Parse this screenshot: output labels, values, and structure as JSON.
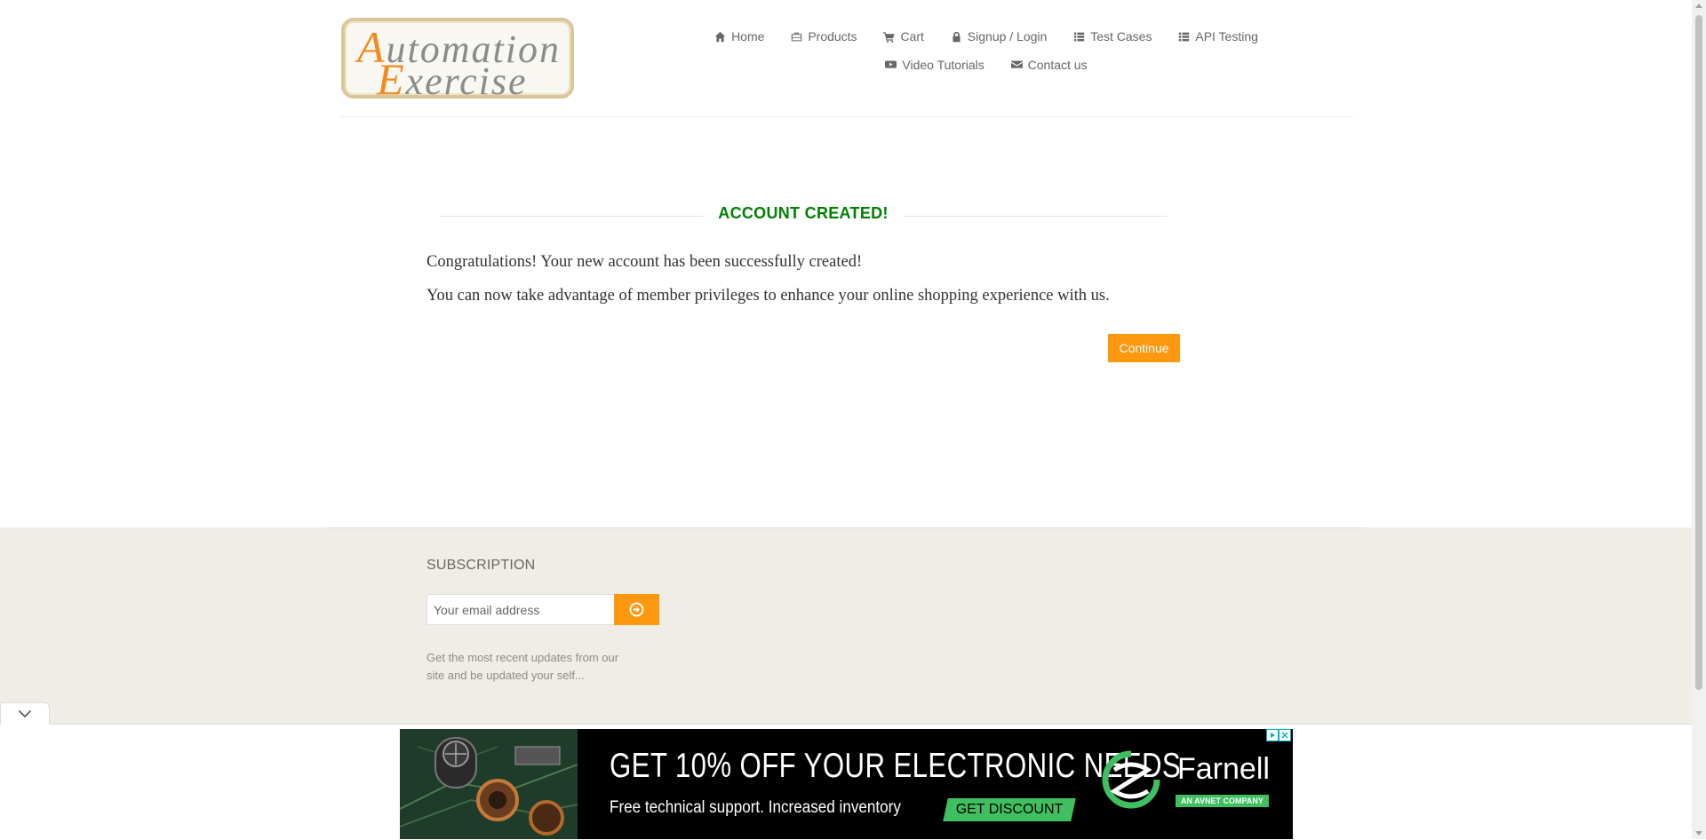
{
  "logo": {
    "line1_cap": "A",
    "line1_rest": "utomation",
    "line2_cap": "E",
    "line2_rest": "xercise"
  },
  "nav": {
    "items": [
      {
        "label": "Home",
        "icon": "home-icon"
      },
      {
        "label": "Products",
        "icon": "briefcase-icon"
      },
      {
        "label": "Cart",
        "icon": "cart-icon"
      },
      {
        "label": "Signup / Login",
        "icon": "lock-icon"
      },
      {
        "label": "Test Cases",
        "icon": "list-icon"
      },
      {
        "label": "API Testing",
        "icon": "list-icon"
      },
      {
        "label": "Video Tutorials",
        "icon": "youtube-play-icon"
      },
      {
        "label": "Contact us",
        "icon": "envelope-icon"
      }
    ]
  },
  "account": {
    "title": "ACCOUNT CREATED!",
    "message1": "Congratulations! Your new account has been successfully created!",
    "message2": "You can now take advantage of member privileges to enhance your online shopping experience with us.",
    "continue_label": "Continue"
  },
  "footer": {
    "subscription_title": "SUBSCRIPTION",
    "email_placeholder": "Your email address",
    "subscribe_icon": "arrow-circle-right-icon",
    "description": "Get the most recent updates from our site and be updated your self..."
  },
  "ad": {
    "headline": "GET 10% OFF YOUR ELECTRONIC NEEDS",
    "subline": "Free technical support. Increased inventory",
    "cta": "GET DISCOUNT",
    "brand": "Farnell",
    "tagline": "AN AVNET COMPANY"
  },
  "colors": {
    "accent": "#fe980f",
    "success": "#008000",
    "footer_bg": "#efede6",
    "ad_green": "#3fbf5f"
  }
}
